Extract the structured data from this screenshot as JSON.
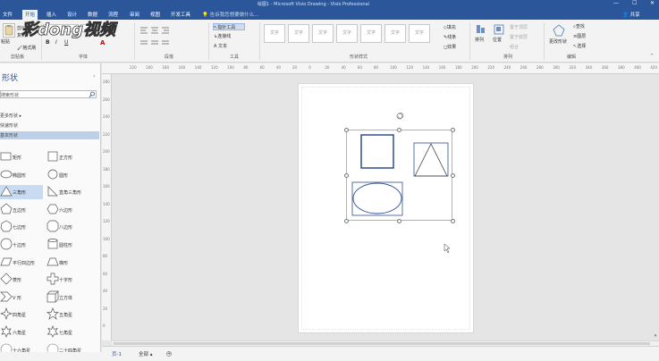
{
  "app": {
    "title": "绘图1 - Microsoft Visio Drawing - Visio Professional",
    "share_label": "共享",
    "tell_me_placeholder": "告诉我您想要做什么..."
  },
  "colors": {
    "accent": "#2b579a",
    "selection": "#c9dbf2",
    "shape_stroke": "#2f4f8f"
  },
  "tabs": [
    {
      "label": "文件"
    },
    {
      "label": "开始"
    },
    {
      "label": "插入"
    },
    {
      "label": "设计"
    },
    {
      "label": "数据"
    },
    {
      "label": "流程"
    },
    {
      "label": "审阅"
    },
    {
      "label": "视图"
    },
    {
      "label": "开发工具"
    }
  ],
  "ribbon": {
    "clipboard": {
      "paste": "粘贴",
      "cut": "剪切",
      "copy": "复制",
      "format_painter": "格式刷",
      "group": "剪贴板"
    },
    "font": {
      "name": "",
      "size": "",
      "group": "字体",
      "bold": "B",
      "italic": "I",
      "underline": "U",
      "grow": "A",
      "color": "A"
    },
    "paragraph": {
      "group": "段落"
    },
    "tools": {
      "pointer": "指针工具",
      "connector": "连接线",
      "text": "文本",
      "group": "工具"
    },
    "shape_styles": {
      "group": "形状样式",
      "fill": "填充",
      "line": "线条",
      "effect": "效果",
      "thumb_text": "文字"
    },
    "arrange": {
      "align": "排列",
      "position": "位置",
      "bring_front": "置于顶层",
      "send_back": "置于底层",
      "group_btn": "组合",
      "group": "排列"
    },
    "editing": {
      "change_shape": "更改形状",
      "find": "查找",
      "layers": "图层",
      "select": "选择",
      "group": "编辑"
    }
  },
  "sidebar": {
    "title": "形状",
    "search_placeholder": "搜索形状",
    "links": [
      {
        "label": "更多形状"
      },
      {
        "label": "快速形状"
      },
      {
        "label": "基本形状"
      }
    ],
    "shapes_left": [
      {
        "label": "矩形",
        "icon": "rect-icon"
      },
      {
        "label": "椭圆形",
        "icon": "ellipse-icon"
      },
      {
        "label": "三角形",
        "icon": "triangle-icon"
      },
      {
        "label": "五边形",
        "icon": "pentagon-icon"
      },
      {
        "label": "七边形",
        "icon": "heptagon-icon"
      },
      {
        "label": "十边形",
        "icon": "decagon-icon"
      },
      {
        "label": "平行四边形",
        "icon": "parallelogram-icon"
      },
      {
        "label": "菱形",
        "icon": "diamond-icon"
      },
      {
        "label": "V 形",
        "icon": "chevron-icon"
      },
      {
        "label": "四角星",
        "icon": "star4-icon"
      },
      {
        "label": "六角星",
        "icon": "star6-icon"
      },
      {
        "label": "十六角星",
        "icon": "star16-icon"
      }
    ],
    "shapes_right": [
      {
        "label": "正方形",
        "icon": "square-icon"
      },
      {
        "label": "圆形",
        "icon": "circle-icon"
      },
      {
        "label": "直角三角形",
        "icon": "right-triangle-icon"
      },
      {
        "label": "六边形",
        "icon": "hexagon-icon"
      },
      {
        "label": "八边形",
        "icon": "octagon-icon"
      },
      {
        "label": "圆柱形",
        "icon": "cylinder-icon"
      },
      {
        "label": "梯形",
        "icon": "trapezoid-icon"
      },
      {
        "label": "十字形",
        "icon": "cross-icon"
      },
      {
        "label": "立方体",
        "icon": "cube-icon"
      },
      {
        "label": "五角星",
        "icon": "star5-icon"
      },
      {
        "label": "七角星",
        "icon": "star7-icon"
      },
      {
        "label": "二十四角星",
        "icon": "star24-icon"
      }
    ],
    "selected_index": 2
  },
  "ruler": {
    "h_labels": [
      "220",
      "200",
      "180",
      "160",
      "140",
      "120",
      "100",
      "80",
      "60",
      "40",
      "20",
      "0",
      "20",
      "40",
      "60",
      "80",
      "100",
      "120",
      "140",
      "160",
      "180",
      "200",
      "220",
      "240",
      "260",
      "280",
      "300",
      "320",
      "340",
      "360",
      "380",
      "400",
      "420"
    ],
    "v_labels": [
      "280",
      "260",
      "240",
      "220",
      "200",
      "180",
      "160",
      "140",
      "120",
      "100",
      "80",
      "60",
      "40",
      "20",
      "0"
    ]
  },
  "statusbar": {
    "page_tab": "页-1",
    "all_pages": "全部",
    "add_page": "+"
  },
  "watermark": {
    "text": "彩dong视频"
  }
}
